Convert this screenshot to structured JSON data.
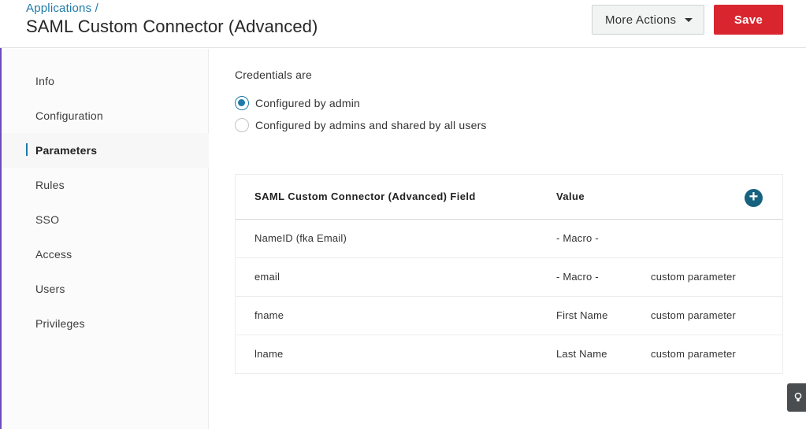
{
  "header": {
    "breadcrumb": "Applications /",
    "title": "SAML Custom Connector (Advanced)",
    "more_actions_label": "More Actions",
    "save_label": "Save"
  },
  "sidebar": {
    "items": [
      {
        "label": "Info"
      },
      {
        "label": "Configuration"
      },
      {
        "label": "Parameters",
        "active": true
      },
      {
        "label": "Rules"
      },
      {
        "label": "SSO"
      },
      {
        "label": "Access"
      },
      {
        "label": "Users"
      },
      {
        "label": "Privileges"
      }
    ]
  },
  "credentials": {
    "label": "Credentials are",
    "options": [
      {
        "label": "Configured by admin",
        "selected": true
      },
      {
        "label": "Configured by admins and shared by all users",
        "selected": false
      }
    ]
  },
  "parameters_table": {
    "headers": [
      "SAML Custom Connector (Advanced) Field",
      "Value"
    ],
    "add_icon": "plus-circle-icon",
    "rows": [
      {
        "field": "NameID (fka Email)",
        "value": "- Macro -",
        "type": ""
      },
      {
        "field": "email",
        "value": "- Macro -",
        "type": "custom parameter"
      },
      {
        "field": "fname",
        "value": "First Name",
        "type": "custom parameter"
      },
      {
        "field": "lname",
        "value": "Last Name",
        "type": "custom parameter"
      }
    ]
  },
  "colors": {
    "accent": "#1e7aa8",
    "save": "#d9262e",
    "add_button": "#17627e"
  },
  "help_icon": "lightbulb-icon"
}
